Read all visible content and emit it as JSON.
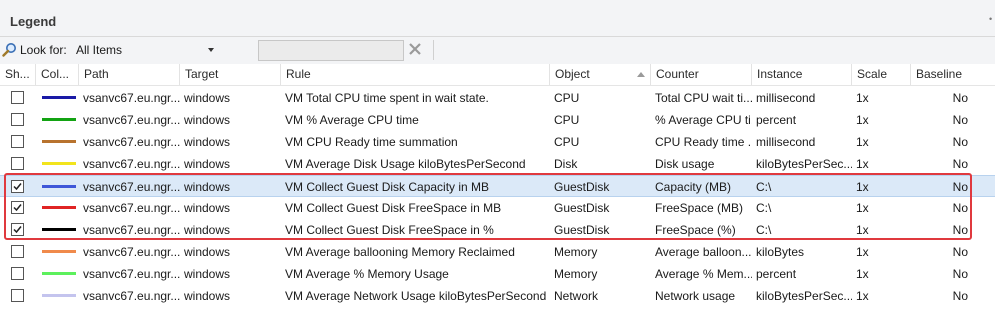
{
  "panel": {
    "title": "Legend"
  },
  "toolbar": {
    "look_for_label": "Look for:",
    "look_for_value": "All Items",
    "search_value": ""
  },
  "columns": {
    "show": "Sh...",
    "color": "Col...",
    "path": "Path",
    "target": "Target",
    "rule": "Rule",
    "object": "Object",
    "counter": "Counter",
    "instance": "Instance",
    "scale": "Scale",
    "baseline": "Baseline"
  },
  "colors": {
    "selected_row": "#dbe9f8",
    "highlight_border": "#e0393e"
  },
  "rows": [
    {
      "checked": false,
      "selected": false,
      "color": "#1a1aa6",
      "path": "vsanvc67.eu.ngr...",
      "target": "windows",
      "rule": "VM Total CPU time spent in wait state.",
      "object": "CPU",
      "counter": "Total CPU wait ti...",
      "instance": "millisecond",
      "scale": "1x",
      "baseline": "No"
    },
    {
      "checked": false,
      "selected": false,
      "color": "#13a313",
      "path": "vsanvc67.eu.ngr...",
      "target": "windows",
      "rule": "VM % Average CPU time",
      "object": "CPU",
      "counter": "% Average CPU ti...",
      "instance": "percent",
      "scale": "1x",
      "baseline": "No"
    },
    {
      "checked": false,
      "selected": false,
      "color": "#b8732e",
      "path": "vsanvc67.eu.ngr...",
      "target": "windows",
      "rule": "VM CPU Ready time summation",
      "object": "CPU",
      "counter": "CPU Ready time ...",
      "instance": "millisecond",
      "scale": "1x",
      "baseline": "No"
    },
    {
      "checked": false,
      "selected": false,
      "color": "#f2e41c",
      "path": "vsanvc67.eu.ngr...",
      "target": "windows",
      "rule": "VM Average Disk Usage kiloBytesPerSecond",
      "object": "Disk",
      "counter": "Disk usage",
      "instance": "kiloBytesPerSec...",
      "scale": "1x",
      "baseline": "No"
    },
    {
      "checked": true,
      "selected": true,
      "color": "#3f57d8",
      "path": "vsanvc67.eu.ngr...",
      "target": "windows",
      "rule": "VM Collect Guest Disk Capacity in MB",
      "object": "GuestDisk",
      "counter": "Capacity (MB)",
      "instance": "C:\\",
      "scale": "1x",
      "baseline": "No"
    },
    {
      "checked": true,
      "selected": false,
      "color": "#e02424",
      "path": "vsanvc67.eu.ngr...",
      "target": "windows",
      "rule": "VM Collect Guest Disk FreeSpace in MB",
      "object": "GuestDisk",
      "counter": "FreeSpace (MB)",
      "instance": "C:\\",
      "scale": "1x",
      "baseline": "No"
    },
    {
      "checked": true,
      "selected": false,
      "color": "#000000",
      "path": "vsanvc67.eu.ngr...",
      "target": "windows",
      "rule": "VM Collect Guest Disk FreeSpace in %",
      "object": "GuestDisk",
      "counter": "FreeSpace (%)",
      "instance": "C:\\",
      "scale": "1x",
      "baseline": "No"
    },
    {
      "checked": false,
      "selected": false,
      "color": "#f08a4b",
      "path": "vsanvc67.eu.ngr...",
      "target": "windows",
      "rule": "VM Average ballooning Memory Reclaimed",
      "object": "Memory",
      "counter": "Average balloon...",
      "instance": "kiloBytes",
      "scale": "1x",
      "baseline": "No"
    },
    {
      "checked": false,
      "selected": false,
      "color": "#5cf05c",
      "path": "vsanvc67.eu.ngr...",
      "target": "windows",
      "rule": "VM Average % Memory Usage",
      "object": "Memory",
      "counter": "Average % Mem...",
      "instance": "percent",
      "scale": "1x",
      "baseline": "No"
    },
    {
      "checked": false,
      "selected": false,
      "color": "#c4c4ee",
      "path": "vsanvc67.eu.ngr...",
      "target": "windows",
      "rule": "VM Average Network Usage kiloBytesPerSecond",
      "object": "Network",
      "counter": "Network usage",
      "instance": "kiloBytesPerSec...",
      "scale": "1x",
      "baseline": "No"
    }
  ]
}
